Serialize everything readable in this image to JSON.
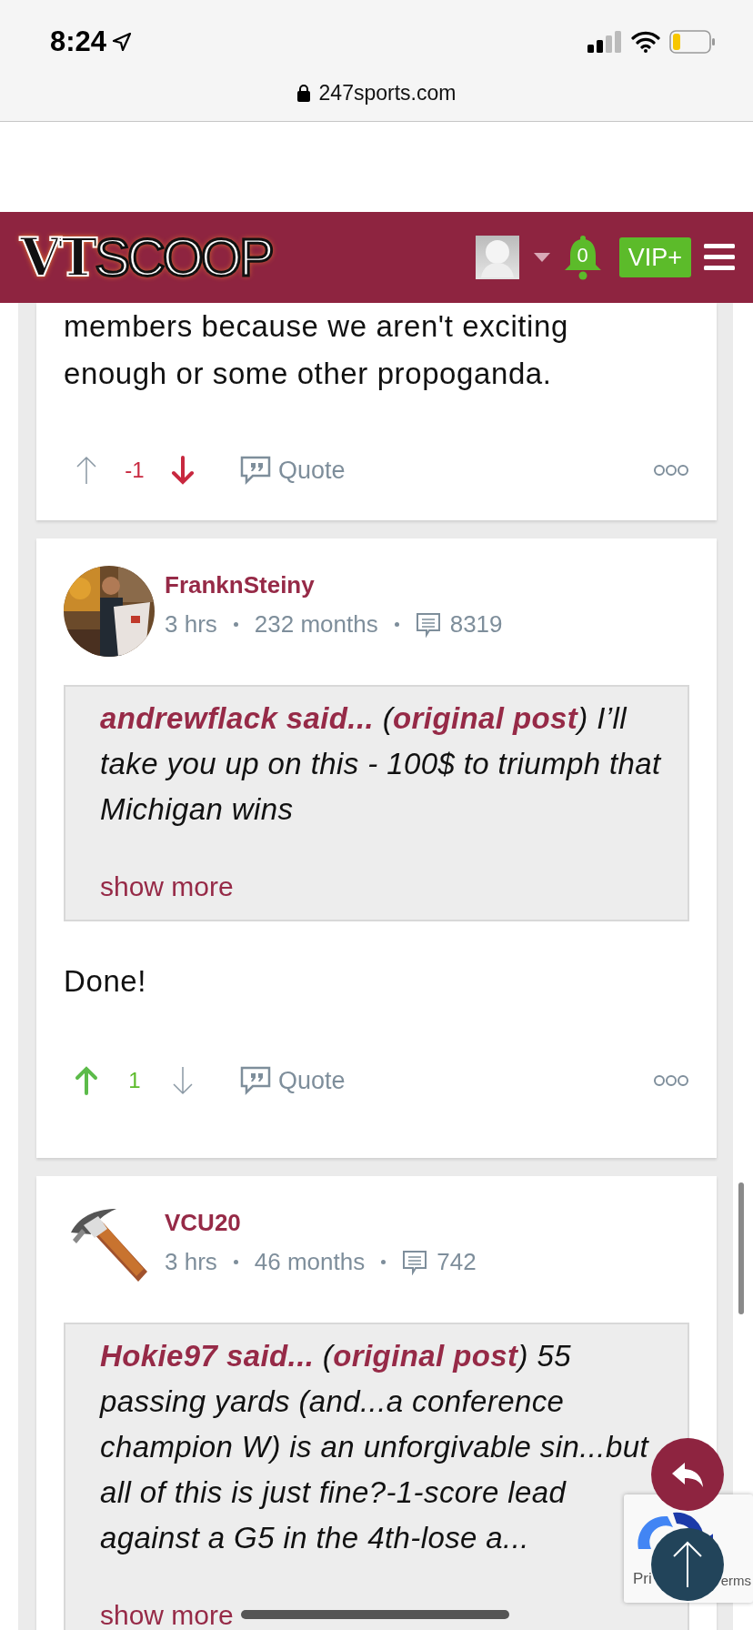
{
  "status_bar": {
    "time": "8:24"
  },
  "browser": {
    "url": "247sports.com"
  },
  "nav": {
    "logo_bold": "VT",
    "logo_rest": "SCOOP",
    "notifications": "0",
    "vip": "VIP+"
  },
  "posts": [
    {
      "kind": "continued",
      "body": "members because we aren't exciting enough or some other propoganda.",
      "score": "-1",
      "upvoted": false,
      "downvoted": true,
      "quote_label": "Quote"
    },
    {
      "kind": "full",
      "author": "FranknSteiny",
      "time": "3 hrs",
      "tenure": "232 months",
      "post_count": "8319",
      "quote": {
        "before_link": "**andrewflack said...** (",
        "link": "original post",
        "after_link": ") I’ll take you up on this - 100$ to triumph that Michigan wins",
        "show_more": "show more"
      },
      "body": "Done!",
      "score": "1",
      "upvoted": true,
      "downvoted": false,
      "quote_label": "Quote"
    },
    {
      "kind": "full",
      "author": "VCU20",
      "time": "3 hrs",
      "tenure": "46 months",
      "post_count": "742",
      "quote": {
        "before_link": "**Hokie97 said...** (",
        "link": "original post",
        "after_link": ") 55 passing yards (and...a conference champion W) is an unforgivable sin...but all of this is just fine?-1-score lead against a G5 in the 4th-lose a...",
        "show_more": "show more"
      }
    }
  ],
  "recaptcha": {
    "left_text": "Pri",
    "right_text": "erms"
  }
}
